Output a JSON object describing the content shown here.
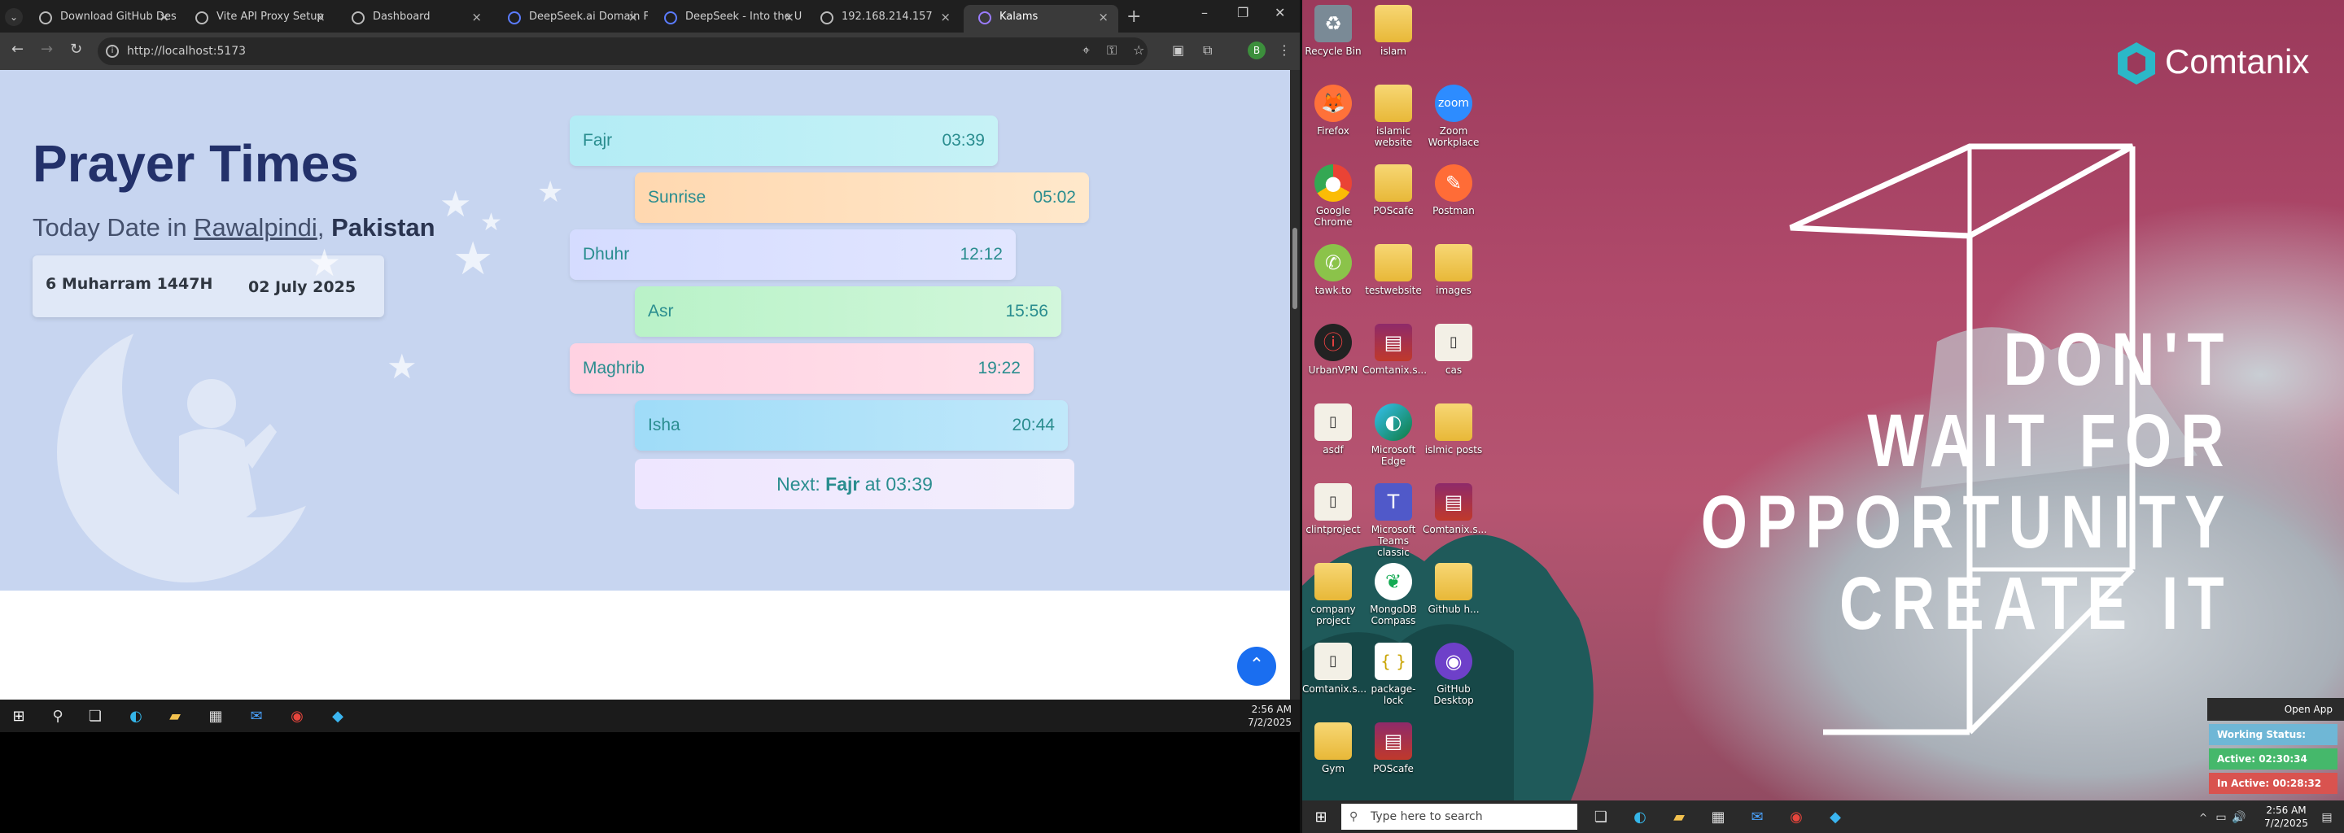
{
  "browser": {
    "tabs": [
      {
        "label": "Download GitHub Des",
        "active": false
      },
      {
        "label": "Vite API Proxy Setup",
        "active": false
      },
      {
        "label": "Dashboard",
        "active": false
      },
      {
        "label": "DeepSeek.ai Domain F",
        "active": false
      },
      {
        "label": "DeepSeek - Into the U",
        "active": false
      },
      {
        "label": "192.168.214.157",
        "active": false
      },
      {
        "label": "Kalams",
        "active": true
      }
    ],
    "url": "http://localhost:5173",
    "profile_initial": "B"
  },
  "page": {
    "title": "Prayer Times",
    "subtitle_prefix": "Today Date in ",
    "city": "Rawalpindi",
    "separator": ",",
    "country": "Pakistan",
    "hijri_date": "6 Muharram 1447H",
    "gregorian_date": "02 July 2025",
    "prayers": [
      {
        "name": "Fajr",
        "time": "03:39"
      },
      {
        "name": "Sunrise",
        "time": "05:02"
      },
      {
        "name": "Dhuhr",
        "time": "12:12"
      },
      {
        "name": "Asr",
        "time": "15:56"
      },
      {
        "name": "Maghrib",
        "time": "19:22"
      },
      {
        "name": "Isha",
        "time": "20:44"
      }
    ],
    "next": {
      "prefix": "Next: ",
      "name": "Fajr",
      "mid": " at ",
      "time": "03:39"
    }
  },
  "taskbar_left": {
    "time": "2:56 AM",
    "date": "7/2/2025"
  },
  "desktop": {
    "icons": [
      {
        "label": "Recycle Bin"
      },
      {
        "label": "islam"
      },
      {
        "label": "Firefox"
      },
      {
        "label": "islamic website"
      },
      {
        "label": "Zoom Workplace"
      },
      {
        "label": "Google Chrome"
      },
      {
        "label": "POScafe"
      },
      {
        "label": "Postman"
      },
      {
        "label": "tawk.to"
      },
      {
        "label": "testwebsite"
      },
      {
        "label": "images"
      },
      {
        "label": "UrbanVPN"
      },
      {
        "label": "Comtanix.s..."
      },
      {
        "label": "cas"
      },
      {
        "label": "asdf"
      },
      {
        "label": "Microsoft Edge"
      },
      {
        "label": "islmic posts"
      },
      {
        "label": "clintproject"
      },
      {
        "label": "Microsoft Teams classic"
      },
      {
        "label": "Comtanix.s..."
      },
      {
        "label": "company project"
      },
      {
        "label": "MongoDB Compass"
      },
      {
        "label": "Github h..."
      },
      {
        "label": "Comtanix.s..."
      },
      {
        "label": "package-lock"
      },
      {
        "label": "GitHub Desktop"
      },
      {
        "label": "Gym"
      },
      {
        "label": "POScafe"
      }
    ],
    "logo": "Comtanix",
    "slogan": [
      "DON'T",
      "WAIT FOR",
      "OPPORTUNITY",
      "CREATE IT"
    ]
  },
  "tracker": {
    "open_app": "Open App",
    "working": "Working Status: Active",
    "active": "Active: 02:30:34",
    "inactive": "In Active: 00:28:32"
  },
  "taskbar_right": {
    "search_placeholder": "Type here to search",
    "time": "2:56 AM",
    "date": "7/2/2025"
  },
  "colors": {
    "title": "#23316a",
    "hero_bg": "#c7d5f0",
    "accent": "#2a8d8f"
  }
}
